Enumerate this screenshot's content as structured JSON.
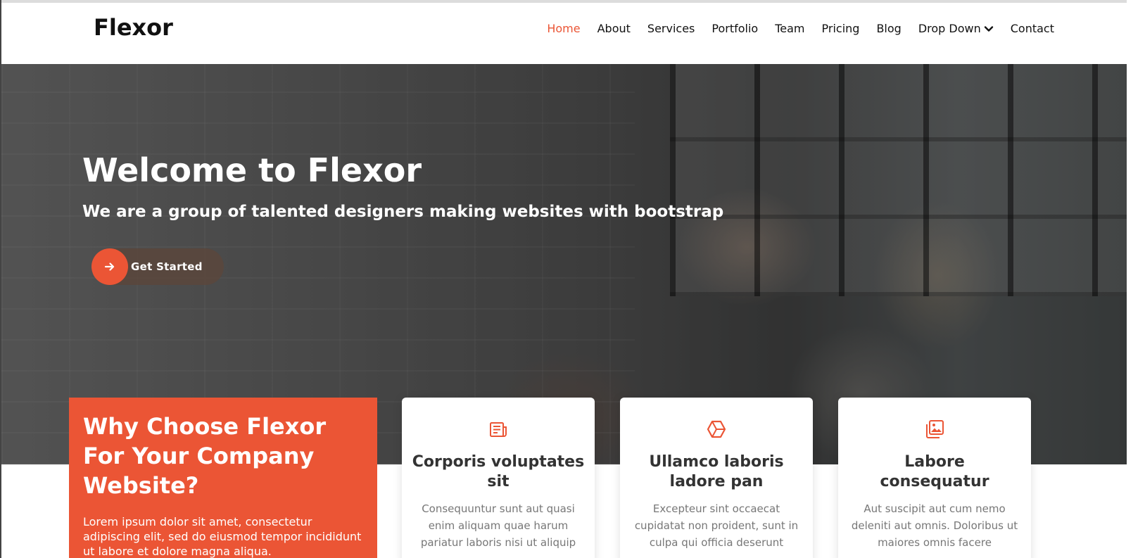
{
  "brand": {
    "logo": "Flexor",
    "accent_color": "#eb5535"
  },
  "nav": {
    "items": [
      {
        "label": "Home",
        "active": true
      },
      {
        "label": "About"
      },
      {
        "label": "Services"
      },
      {
        "label": "Portfolio"
      },
      {
        "label": "Team"
      },
      {
        "label": "Pricing"
      },
      {
        "label": "Blog"
      },
      {
        "label": "Drop Down",
        "icon": "chevron-down-icon"
      },
      {
        "label": "Contact"
      }
    ]
  },
  "hero": {
    "title": "Welcome to Flexor",
    "subtitle": "We are a group of talented designers making websites with bootstrap",
    "cta_label": "Get Started",
    "cta_icon": "arrow-right-icon"
  },
  "why": {
    "title": "Why Choose Flexor For Your Company Website?",
    "text": "Lorem ipsum dolor sit amet, consectetur adipiscing elit, sed do eiusmod tempor incididunt ut labore et dolore magna aliqua."
  },
  "cards": [
    {
      "icon": "newspaper-icon",
      "title": "Corporis voluptates sit",
      "text": "Consequuntur sunt aut quasi enim aliquam quae harum pariatur laboris nisi ut aliquip"
    },
    {
      "icon": "hexagon-cube-icon",
      "title": "Ullamco laboris ladore pan",
      "text": "Excepteur sint occaecat cupidatat non proident, sunt in culpa qui officia deserunt"
    },
    {
      "icon": "images-icon",
      "title": "Labore consequatur",
      "text": "Aut suscipit aut cum nemo deleniti aut omnis. Doloribus ut maiores omnis facere"
    }
  ]
}
